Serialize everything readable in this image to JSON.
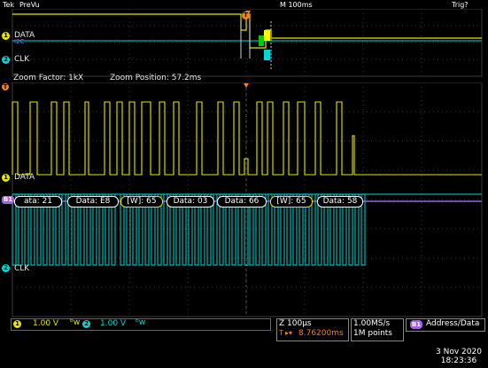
{
  "top": {
    "brand": "Tek",
    "mode": "PreVu",
    "timebase": "M 100ms",
    "trigger_status": "Trig?",
    "ch1_label": "DATA",
    "ch2_label": "CLK",
    "bus_label": "I2C"
  },
  "zoom": {
    "factor": "Zoom Factor: 1kX",
    "position": "Zoom Position: 57.2ms",
    "ch1_label": "DATA",
    "ch2_label": "CLK",
    "bus_badge": "B1"
  },
  "bus_packets": [
    "ata: 21",
    "Data: E8",
    "[W]: 65",
    "Data: 03",
    "Data: 66",
    "[W]: 65",
    "Data: 58"
  ],
  "status": {
    "ch1_num": "1",
    "ch1_volts": "1.00 V",
    "ch2_num": "2",
    "ch2_volts": "1.00 V",
    "coupling_icon": "bandwidth-icon",
    "zoom_time": "Z 100µs",
    "trigger_time": "8.76200ms",
    "trigger_prefix": "T",
    "sample_rate": "1.00MS/s",
    "record_length": "1M points",
    "bus_num": "B1",
    "bus_title": "Address/Data",
    "date": "3 Nov 2020",
    "time": "18:23:36"
  },
  "colors": {
    "ch1": "#e6e600",
    "ch2": "#00d8d8",
    "bus": "#a060e0",
    "grid": "#3a3a3a",
    "trigger": "#f08020"
  }
}
